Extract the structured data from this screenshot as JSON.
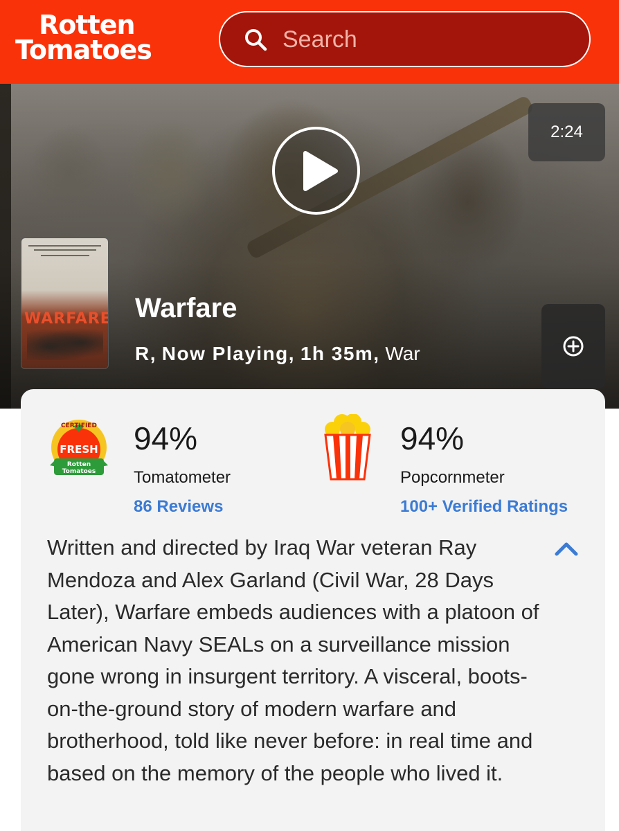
{
  "header": {
    "logo_line1": "Rotten",
    "logo_line2": "Tomatoes",
    "search_placeholder": "Search",
    "search_icon": "search-icon",
    "brand_color": "#fa320a"
  },
  "hero": {
    "video_duration": "2:24",
    "play_icon": "play-icon",
    "add_icon": "plus-circle-icon",
    "poster_title": "WARFARE"
  },
  "movie": {
    "title": "Warfare",
    "rating": "R,",
    "status": "Now Playing,",
    "runtime": "1h 35m,",
    "genre": "War"
  },
  "scores": {
    "tomatometer": {
      "badge_icon": "certified-fresh-icon",
      "badge_top": "CERTIFIED",
      "badge_main": "FRESH",
      "badge_logo_1": "Rotten",
      "badge_logo_2": "Tomatoes",
      "percent": "94%",
      "label": "Tomatometer",
      "link": "86 Reviews"
    },
    "popcornmeter": {
      "icon": "popcorn-icon",
      "percent": "94%",
      "label": "Popcornmeter",
      "link": "100+ Verified Ratings"
    }
  },
  "synopsis": {
    "text": "Written and directed by Iraq War veteran Ray Mendoza and Alex Garland (Civil War, 28 Days Later), Warfare embeds audiences with a platoon of American Navy SEALs on a surveillance mission gone wrong in insurgent territory. A visceral, boots-on-the-ground story of modern warfare and brotherhood, told like never before: in real time and based on the memory of the people who lived it.",
    "toggle_icon": "chevron-up-icon",
    "accent_color": "#3b7bd4"
  }
}
